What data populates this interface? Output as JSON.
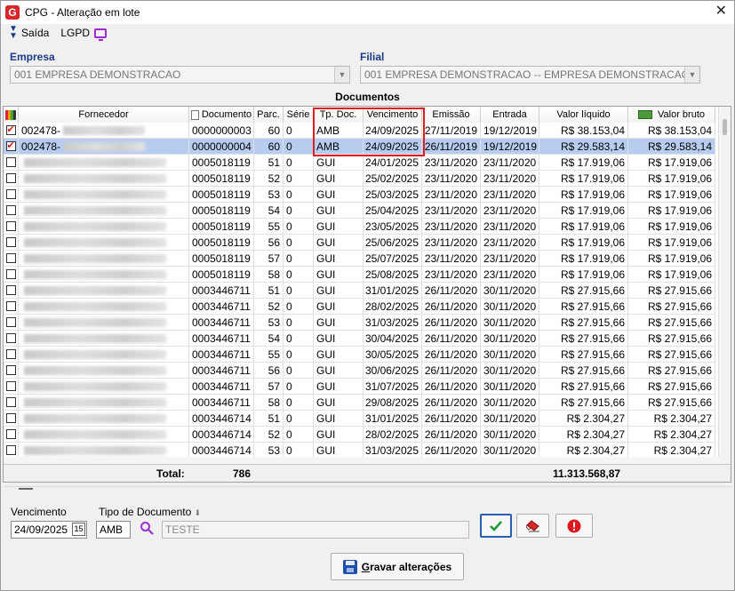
{
  "window": {
    "title": "CPG - Alteração em lote",
    "app_icon_letter": "G"
  },
  "menu": {
    "exit_label": "Saída",
    "lgpd_label": "LGPD"
  },
  "filters": {
    "empresa_label": "Empresa",
    "empresa_value": "001 EMPRESA DEMONSTRACAO",
    "filial_label": "Filial",
    "filial_value": "001 EMPRESA DEMONSTRACAO -- EMPRESA DEMONSTRACAO"
  },
  "grid": {
    "title": "Documentos",
    "columns": [
      "",
      "Fornecedor",
      "Documento",
      "Parc.",
      "Série",
      "Tp. Doc.",
      "Vencimento",
      "Emissão",
      "Entrada",
      "Valor líquido",
      "Valor bruto"
    ],
    "rows": [
      {
        "checked": true,
        "fornecedor": "002478-",
        "documento": "0000000003",
        "parc": "60",
        "serie": "0",
        "tp_doc": "AMB",
        "vencimento": "24/09/2025",
        "emissao": "27/11/2019",
        "entrada": "19/12/2019",
        "valor_liquido": "R$ 38.153,04",
        "valor_bruto": "R$ 38.153,04"
      },
      {
        "checked": true,
        "fornecedor": "002478-",
        "documento": "0000000004",
        "parc": "60",
        "serie": "0",
        "tp_doc": "AMB",
        "vencimento": "24/09/2025",
        "emissao": "26/11/2019",
        "entrada": "19/12/2019",
        "valor_liquido": "R$ 29.583,14",
        "valor_bruto": "R$ 29.583,14",
        "selected": true
      },
      {
        "checked": false,
        "fornecedor": "",
        "documento": "0005018119",
        "parc": "51",
        "serie": "0",
        "tp_doc": "GUI",
        "vencimento": "24/01/2025",
        "emissao": "23/11/2020",
        "entrada": "23/11/2020",
        "valor_liquido": "R$ 17.919,06",
        "valor_bruto": "R$ 17.919,06"
      },
      {
        "checked": false,
        "fornecedor": "",
        "documento": "0005018119",
        "parc": "52",
        "serie": "0",
        "tp_doc": "GUI",
        "vencimento": "25/02/2025",
        "emissao": "23/11/2020",
        "entrada": "23/11/2020",
        "valor_liquido": "R$ 17.919,06",
        "valor_bruto": "R$ 17.919,06"
      },
      {
        "checked": false,
        "fornecedor": "",
        "documento": "0005018119",
        "parc": "53",
        "serie": "0",
        "tp_doc": "GUI",
        "vencimento": "25/03/2025",
        "emissao": "23/11/2020",
        "entrada": "23/11/2020",
        "valor_liquido": "R$ 17.919,06",
        "valor_bruto": "R$ 17.919,06"
      },
      {
        "checked": false,
        "fornecedor": "",
        "documento": "0005018119",
        "parc": "54",
        "serie": "0",
        "tp_doc": "GUI",
        "vencimento": "25/04/2025",
        "emissao": "23/11/2020",
        "entrada": "23/11/2020",
        "valor_liquido": "R$ 17.919,06",
        "valor_bruto": "R$ 17.919,06"
      },
      {
        "checked": false,
        "fornecedor": "",
        "documento": "0005018119",
        "parc": "55",
        "serie": "0",
        "tp_doc": "GUI",
        "vencimento": "23/05/2025",
        "emissao": "23/11/2020",
        "entrada": "23/11/2020",
        "valor_liquido": "R$ 17.919,06",
        "valor_bruto": "R$ 17.919,06"
      },
      {
        "checked": false,
        "fornecedor": "",
        "documento": "0005018119",
        "parc": "56",
        "serie": "0",
        "tp_doc": "GUI",
        "vencimento": "25/06/2025",
        "emissao": "23/11/2020",
        "entrada": "23/11/2020",
        "valor_liquido": "R$ 17.919,06",
        "valor_bruto": "R$ 17.919,06"
      },
      {
        "checked": false,
        "fornecedor": "",
        "documento": "0005018119",
        "parc": "57",
        "serie": "0",
        "tp_doc": "GUI",
        "vencimento": "25/07/2025",
        "emissao": "23/11/2020",
        "entrada": "23/11/2020",
        "valor_liquido": "R$ 17.919,06",
        "valor_bruto": "R$ 17.919,06"
      },
      {
        "checked": false,
        "fornecedor": "",
        "documento": "0005018119",
        "parc": "58",
        "serie": "0",
        "tp_doc": "GUI",
        "vencimento": "25/08/2025",
        "emissao": "23/11/2020",
        "entrada": "23/11/2020",
        "valor_liquido": "R$ 17.919,06",
        "valor_bruto": "R$ 17.919,06"
      },
      {
        "checked": false,
        "fornecedor": "",
        "documento": "0003446711",
        "parc": "51",
        "serie": "0",
        "tp_doc": "GUI",
        "vencimento": "31/01/2025",
        "emissao": "26/11/2020",
        "entrada": "30/11/2020",
        "valor_liquido": "R$ 27.915,66",
        "valor_bruto": "R$ 27.915,66"
      },
      {
        "checked": false,
        "fornecedor": "",
        "documento": "0003446711",
        "parc": "52",
        "serie": "0",
        "tp_doc": "GUI",
        "vencimento": "28/02/2025",
        "emissao": "26/11/2020",
        "entrada": "30/11/2020",
        "valor_liquido": "R$ 27.915,66",
        "valor_bruto": "R$ 27.915,66"
      },
      {
        "checked": false,
        "fornecedor": "",
        "documento": "0003446711",
        "parc": "53",
        "serie": "0",
        "tp_doc": "GUI",
        "vencimento": "31/03/2025",
        "emissao": "26/11/2020",
        "entrada": "30/11/2020",
        "valor_liquido": "R$ 27.915,66",
        "valor_bruto": "R$ 27.915,66"
      },
      {
        "checked": false,
        "fornecedor": "",
        "documento": "0003446711",
        "parc": "54",
        "serie": "0",
        "tp_doc": "GUI",
        "vencimento": "30/04/2025",
        "emissao": "26/11/2020",
        "entrada": "30/11/2020",
        "valor_liquido": "R$ 27.915,66",
        "valor_bruto": "R$ 27.915,66"
      },
      {
        "checked": false,
        "fornecedor": "",
        "documento": "0003446711",
        "parc": "55",
        "serie": "0",
        "tp_doc": "GUI",
        "vencimento": "30/05/2025",
        "emissao": "26/11/2020",
        "entrada": "30/11/2020",
        "valor_liquido": "R$ 27.915,66",
        "valor_bruto": "R$ 27.915,66"
      },
      {
        "checked": false,
        "fornecedor": "",
        "documento": "0003446711",
        "parc": "56",
        "serie": "0",
        "tp_doc": "GUI",
        "vencimento": "30/06/2025",
        "emissao": "26/11/2020",
        "entrada": "30/11/2020",
        "valor_liquido": "R$ 27.915,66",
        "valor_bruto": "R$ 27.915,66"
      },
      {
        "checked": false,
        "fornecedor": "",
        "documento": "0003446711",
        "parc": "57",
        "serie": "0",
        "tp_doc": "GUI",
        "vencimento": "31/07/2025",
        "emissao": "26/11/2020",
        "entrada": "30/11/2020",
        "valor_liquido": "R$ 27.915,66",
        "valor_bruto": "R$ 27.915,66"
      },
      {
        "checked": false,
        "fornecedor": "",
        "documento": "0003446711",
        "parc": "58",
        "serie": "0",
        "tp_doc": "GUI",
        "vencimento": "29/08/2025",
        "emissao": "26/11/2020",
        "entrada": "30/11/2020",
        "valor_liquido": "R$ 27.915,66",
        "valor_bruto": "R$ 27.915,66"
      },
      {
        "checked": false,
        "fornecedor": "",
        "documento": "0003446714",
        "parc": "51",
        "serie": "0",
        "tp_doc": "GUI",
        "vencimento": "31/01/2025",
        "emissao": "26/11/2020",
        "entrada": "30/11/2020",
        "valor_liquido": "R$ 2.304,27",
        "valor_bruto": "R$ 2.304,27"
      },
      {
        "checked": false,
        "fornecedor": "",
        "documento": "0003446714",
        "parc": "52",
        "serie": "0",
        "tp_doc": "GUI",
        "vencimento": "28/02/2025",
        "emissao": "26/11/2020",
        "entrada": "30/11/2020",
        "valor_liquido": "R$ 2.304,27",
        "valor_bruto": "R$ 2.304,27"
      },
      {
        "checked": false,
        "fornecedor": "",
        "documento": "0003446714",
        "parc": "53",
        "serie": "0",
        "tp_doc": "GUI",
        "vencimento": "31/03/2025",
        "emissao": "26/11/2020",
        "entrada": "30/11/2020",
        "valor_liquido": "R$ 2.304,27",
        "valor_bruto": "R$ 2.304,27"
      }
    ],
    "footer": {
      "total_label": "Total:",
      "count": "786",
      "total_value": "11.313.568,87"
    }
  },
  "editor": {
    "vencimento_label": "Vencimento",
    "vencimento_value": "24/09/2025",
    "tipo_doc_label": "Tipo de Documento",
    "tipo_doc_code": "AMB",
    "tipo_doc_desc": "TESTE",
    "save_label_prefix": "",
    "save_label_underlined": "G",
    "save_label_rest": "ravar alterações"
  },
  "colors": {
    "highlight": "#e01e1e",
    "selected_row": "#b7cdf0",
    "accent": "#1c3a8a"
  }
}
